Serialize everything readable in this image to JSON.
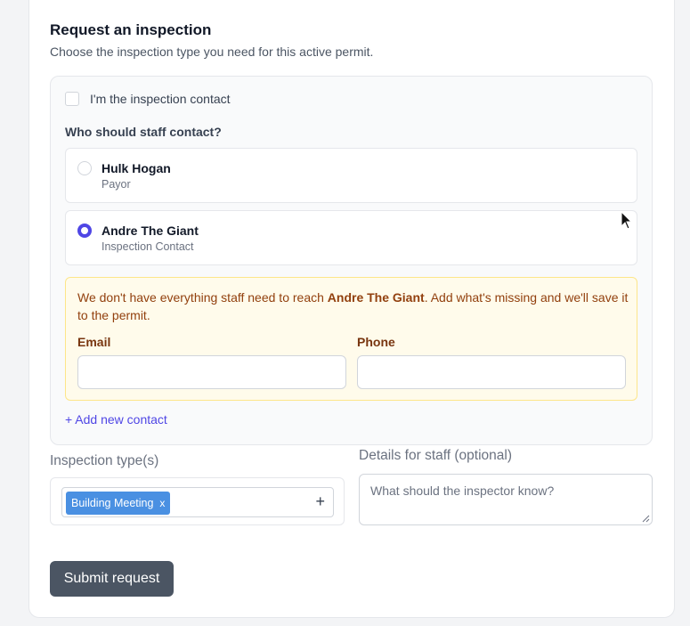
{
  "header": {
    "title": "Request an inspection",
    "subtitle": "Choose the inspection type you need for this active permit."
  },
  "contact": {
    "self_checkbox_label": "I'm the inspection contact",
    "who_label": "Who should staff contact?",
    "options": [
      {
        "name": "Hulk Hogan",
        "role": "Payor",
        "selected": false
      },
      {
        "name": "Andre The Giant",
        "role": "Inspection Contact",
        "selected": true
      }
    ],
    "warning": {
      "prefix": "We don't have everything staff need to reach ",
      "name": "Andre The Giant",
      "suffix": ". Add what's missing and we'll save it to the permit.",
      "email_label": "Email",
      "email_value": "",
      "phone_label": "Phone",
      "phone_value": ""
    },
    "add_contact_label": "+ Add new contact"
  },
  "inspection": {
    "types_label": "Inspection type(s)",
    "selected_types": [
      "Building Meeting"
    ],
    "tag_remove": "x",
    "add_icon": "+",
    "details_label": "Details for staff (optional)",
    "details_placeholder": "What should the inspector know?"
  },
  "actions": {
    "submit_label": "Submit request"
  },
  "colors": {
    "accent": "#4f46e5",
    "tag": "#4a90e2",
    "warning_bg": "#fffbeb",
    "warning_text": "#92400e",
    "submit_bg": "#4b5563"
  }
}
